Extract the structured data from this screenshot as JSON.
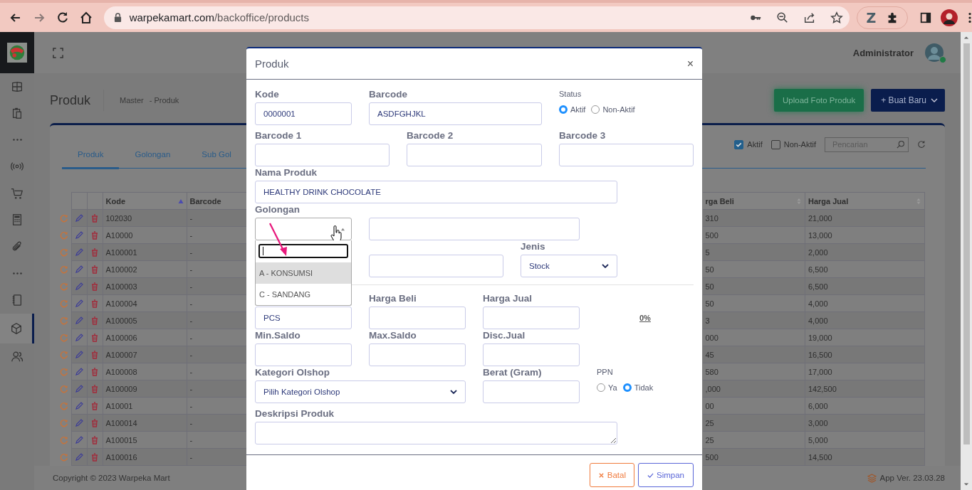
{
  "browser": {
    "url_host": "warpekamart.com",
    "url_path": "/backoffice/products",
    "extension_label": "Z"
  },
  "header": {
    "user": "Administrator"
  },
  "sidebar": {
    "items": [
      {
        "kind": "grid",
        "selected": false
      },
      {
        "kind": "clipboard",
        "selected": false
      },
      {
        "kind": "more",
        "selected": false
      },
      {
        "kind": "broadcast",
        "selected": false
      },
      {
        "kind": "cart",
        "selected": false
      },
      {
        "kind": "calculator",
        "selected": false
      },
      {
        "kind": "clip",
        "selected": false
      },
      {
        "kind": "more",
        "selected": false
      },
      {
        "kind": "notebook",
        "selected": false
      },
      {
        "kind": "box",
        "selected": true
      },
      {
        "kind": "users",
        "selected": false
      }
    ]
  },
  "page": {
    "title": "Produk",
    "breadcrumb": [
      "Master",
      "- Produk"
    ],
    "actions": [
      {
        "kind": "upload",
        "label": "Upload Foto Produk"
      },
      {
        "kind": "create",
        "label": "+ Buat Baru"
      }
    ]
  },
  "tabs": [
    {
      "label": "Produk",
      "selected": true
    },
    {
      "label": "Golongan",
      "selected": false
    },
    {
      "label": "Sub Gol",
      "selected": false
    }
  ],
  "filters": [
    {
      "label": "Aktif",
      "checked": true
    },
    {
      "label": "Non-Aktif",
      "checked": false
    }
  ],
  "search": {
    "placeholder": "Pencarian"
  },
  "table": {
    "left_columns": [
      {
        "label": "Kode",
        "sorted": true
      },
      {
        "label": "Barcode"
      }
    ],
    "right_columns": [
      {
        "label": "rga Beli",
        "sorted": false
      },
      {
        "label": "Harga Jual",
        "sorted": false
      }
    ],
    "rows": [
      {
        "kode": "102030",
        "barcode": "-",
        "harga_beli": "310",
        "harga_jual": "21,000"
      },
      {
        "kode": "A10000",
        "barcode": "-",
        "harga_beli": "500",
        "harga_jual": "13,000"
      },
      {
        "kode": "A100001",
        "barcode": "-",
        "harga_beli": "5",
        "harga_jual": "2,000"
      },
      {
        "kode": "A100002",
        "barcode": "-",
        "harga_beli": "50",
        "harga_jual": "6,500"
      },
      {
        "kode": "A100003",
        "barcode": "-",
        "harga_beli": "50",
        "harga_jual": "6,500"
      },
      {
        "kode": "A100004",
        "barcode": "-",
        "harga_beli": "50",
        "harga_jual": "4,000"
      },
      {
        "kode": "A100005",
        "barcode": "-",
        "harga_beli": "3",
        "harga_jual": "4,000"
      },
      {
        "kode": "A100006",
        "barcode": "-",
        "harga_beli": "000",
        "harga_jual": "19,000"
      },
      {
        "kode": "A100007",
        "barcode": "-",
        "harga_beli": "45",
        "harga_jual": "16,500"
      },
      {
        "kode": "A100008",
        "barcode": "-",
        "harga_beli": "580",
        "harga_jual": "17,000"
      },
      {
        "kode": "A100009",
        "barcode": "-",
        "harga_beli": ",000",
        "harga_jual": "142,500"
      },
      {
        "kode": "A10001",
        "barcode": "-",
        "harga_beli": "00",
        "harga_jual": "6,000"
      },
      {
        "kode": "A100014",
        "barcode": "-",
        "harga_beli": "25",
        "harga_jual": "3,000"
      },
      {
        "kode": "A100015",
        "barcode": "-",
        "harga_beli": "25",
        "harga_jual": "5,000"
      },
      {
        "kode": "A100016",
        "barcode": "-",
        "harga_beli": "500",
        "harga_jual": "14,500"
      }
    ]
  },
  "footer": {
    "copyright": "Copyright © 2023 Warpeka Mart",
    "version": "App Ver. 23.03.28"
  },
  "modal": {
    "title": "Produk",
    "close": "×",
    "fields": [
      {
        "kind": "input",
        "label": "Kode",
        "value": "0000001"
      },
      {
        "kind": "input",
        "label": "Barcode",
        "value": "ASDFGHJKL"
      },
      {
        "kind": "radio",
        "label": "Status",
        "options": [
          {
            "label": "Aktif",
            "selected": true
          },
          {
            "label": "Non-Aktif",
            "selected": false
          }
        ]
      },
      {
        "kind": "input",
        "label": "Barcode 1"
      },
      {
        "kind": "input",
        "label": "Barcode 2"
      },
      {
        "kind": "input",
        "label": "Barcode 3"
      },
      {
        "kind": "input",
        "label": "Nama Produk",
        "value": "HEALTHY DRINK CHOCOLATE"
      },
      {
        "kind": "dropdown",
        "label": "Golongan",
        "expanded": true,
        "options": [
          {
            "label": "A - KONSUMSI",
            "selected": true
          },
          {
            "label": "C - SANDANG",
            "selected": false
          }
        ]
      },
      {
        "kind": "input"
      },
      {
        "kind": "blank"
      },
      {
        "kind": "input"
      },
      {
        "kind": "select",
        "label": "Jenis",
        "value": "Stock"
      },
      {
        "kind": "input",
        "value": "PCS"
      },
      {
        "kind": "input",
        "label": "Harga Beli"
      },
      {
        "kind": "input",
        "label": "Harga Jual"
      },
      {
        "kind": "link",
        "value": "0%"
      },
      {
        "kind": "input",
        "label": "Min.Saldo"
      },
      {
        "kind": "input",
        "label": "Max.Saldo"
      },
      {
        "kind": "input",
        "label": "Disc.Jual"
      },
      {
        "kind": "select",
        "label": "Kategori Olshop",
        "value": "Pilih Kategori Olshop"
      },
      {
        "kind": "input",
        "label": "Berat (Gram)"
      },
      {
        "kind": "radio",
        "label": "PPN",
        "options": [
          {
            "label": "Ya",
            "selected": false
          },
          {
            "label": "Tidak",
            "selected": true
          }
        ]
      },
      {
        "kind": "textarea",
        "label": "Deskripsi Produk"
      }
    ],
    "buttons": [
      {
        "kind": "cancel",
        "label": "Batal"
      },
      {
        "kind": "save",
        "label": "Simpan"
      }
    ]
  }
}
